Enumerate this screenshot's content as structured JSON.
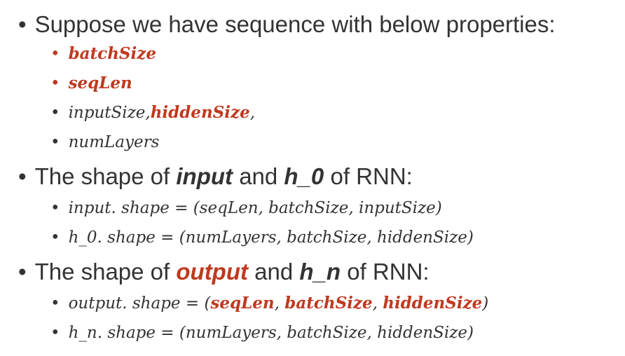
{
  "bullet1": {
    "marker": "•",
    "text": "Suppose we have sequence with below properties:",
    "items": [
      {
        "marker": "•",
        "text": "batchSize"
      },
      {
        "marker": "•",
        "text": "seqLen"
      },
      {
        "marker": "•",
        "text_a": "inputSize,",
        "text_b": "hiddenSize",
        "text_c": ","
      },
      {
        "marker": "•",
        "text": "numLayers"
      }
    ]
  },
  "bullet2": {
    "marker": "•",
    "prefix": "The shape of",
    "emph1": "input",
    "mid": "and",
    "emph2": "h_0",
    "suffix": "of RNN:",
    "items": [
      {
        "marker": "•",
        "text": "input. shape = (seqLen, batchSize, inputSize)"
      },
      {
        "marker": "•",
        "text": "h_0. shape =  (numLayers, batchSize, hiddenSize)"
      }
    ]
  },
  "bullet3": {
    "marker": "•",
    "prefix": "The shape of",
    "emph1": "output",
    "mid": "and",
    "emph2": "h_n",
    "suffix": "of RNN:",
    "items": [
      {
        "marker": "•",
        "lhs": "output. shape = (",
        "p1": "seqLen",
        "sep1": ", ",
        "p2": "batchSize",
        "sep2": ", ",
        "p3": "hiddenSize",
        "rhs": ")"
      },
      {
        "marker": "•",
        "text": "h_n. shape = (numLayers, batchSize, hiddenSize)"
      }
    ]
  },
  "colors": {
    "text": "#333333",
    "accent": "#c0391f"
  }
}
